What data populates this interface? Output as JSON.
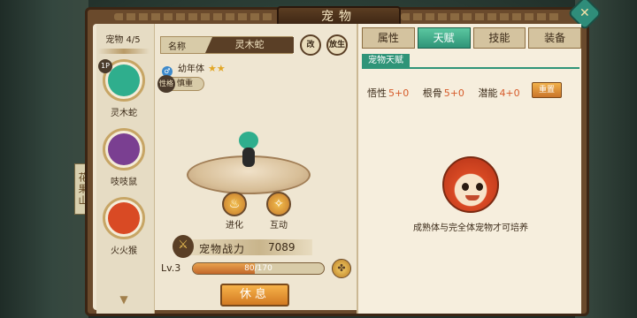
{
  "window": {
    "title": "宠物",
    "close_icon": "close-icon"
  },
  "map": {
    "tag": "花果山"
  },
  "pet_list": {
    "count_label": "宠物 4/5",
    "items": [
      {
        "name": "灵木蛇",
        "badge": "1P",
        "color": "#2fae8d"
      },
      {
        "name": "吱吱鼠",
        "badge": "",
        "color": "#7a3f91"
      },
      {
        "name": "火火猴",
        "badge": "",
        "color": "#d94a24"
      }
    ]
  },
  "pet_info": {
    "name_label": "名称",
    "name_value": "灵木蛇",
    "rename_button": "改",
    "gift_button": "放生",
    "stage": "幼年体",
    "stars": "★★",
    "trait_icon": "性格",
    "trait": "慎重"
  },
  "actions": {
    "evolve": "进化",
    "interact": "互动"
  },
  "power": {
    "label": "宠物战力",
    "value": "7089"
  },
  "level": {
    "label": "Lv.3",
    "xp_text": "80/170",
    "xp_fraction": 0.47
  },
  "rest_button": "休息",
  "tabs": [
    "属性",
    "天赋",
    "技能",
    "装备"
  ],
  "active_tab": 1,
  "talent": {
    "section_label": "宠物天赋",
    "stats": [
      {
        "name": "悟性",
        "value": "5+0"
      },
      {
        "name": "根骨",
        "value": "5+0"
      },
      {
        "name": "潜能",
        "value": "4+0"
      }
    ],
    "reset_button": "重置",
    "message": "成熟体与完全体宠物才可培养"
  },
  "colors": {
    "accent_green": "#2f9478",
    "accent_orange": "#d37a22",
    "stat_value": "#d65b2a"
  }
}
